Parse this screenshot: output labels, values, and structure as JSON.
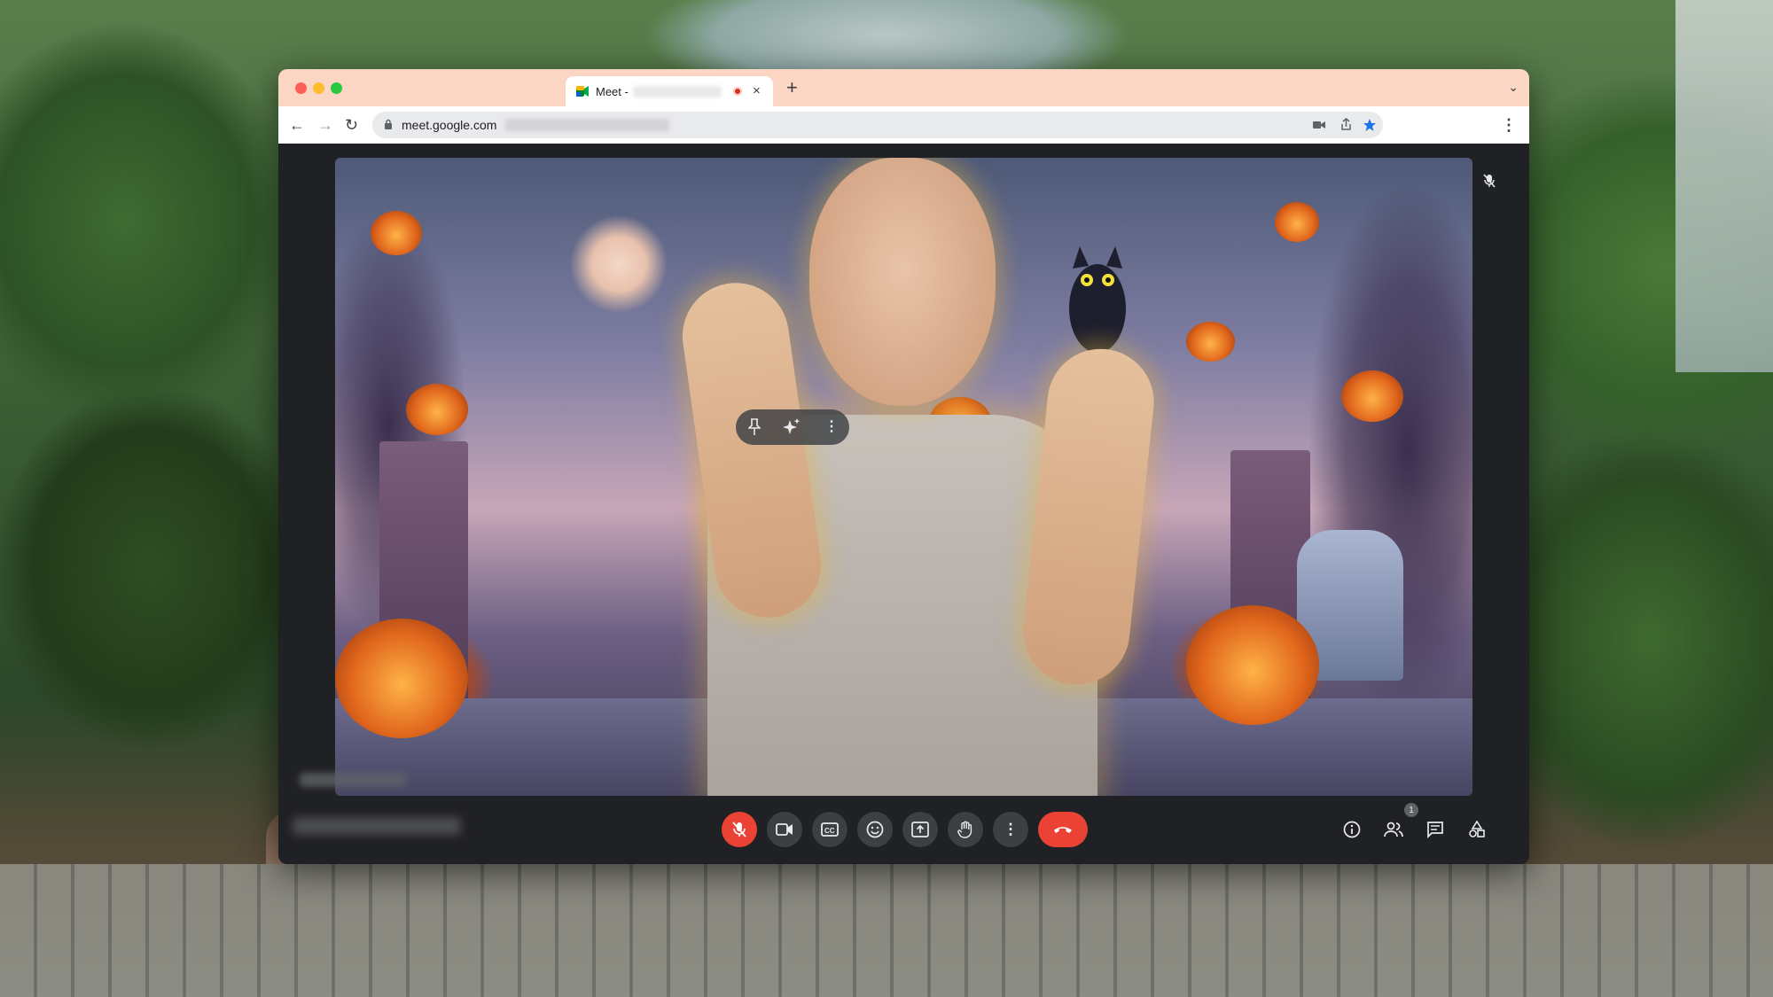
{
  "browser": {
    "tab": {
      "title": "Meet -",
      "close": "×"
    },
    "new_tab": "+",
    "tab_menu": "⌄",
    "nav": {
      "back": "←",
      "forward": "→",
      "reload": "↻"
    },
    "address": {
      "url": "meet.google.com"
    },
    "menu": "⋮"
  },
  "meet": {
    "tile_overlay": {
      "pin": "pin-icon",
      "effects": "sparkle-icon",
      "more": "⋮"
    },
    "participants_count": "1",
    "colors": {
      "background": "#202124",
      "button": "#3c4043",
      "end_call": "#ea4335",
      "titlebar": "#fbd6c3"
    }
  }
}
